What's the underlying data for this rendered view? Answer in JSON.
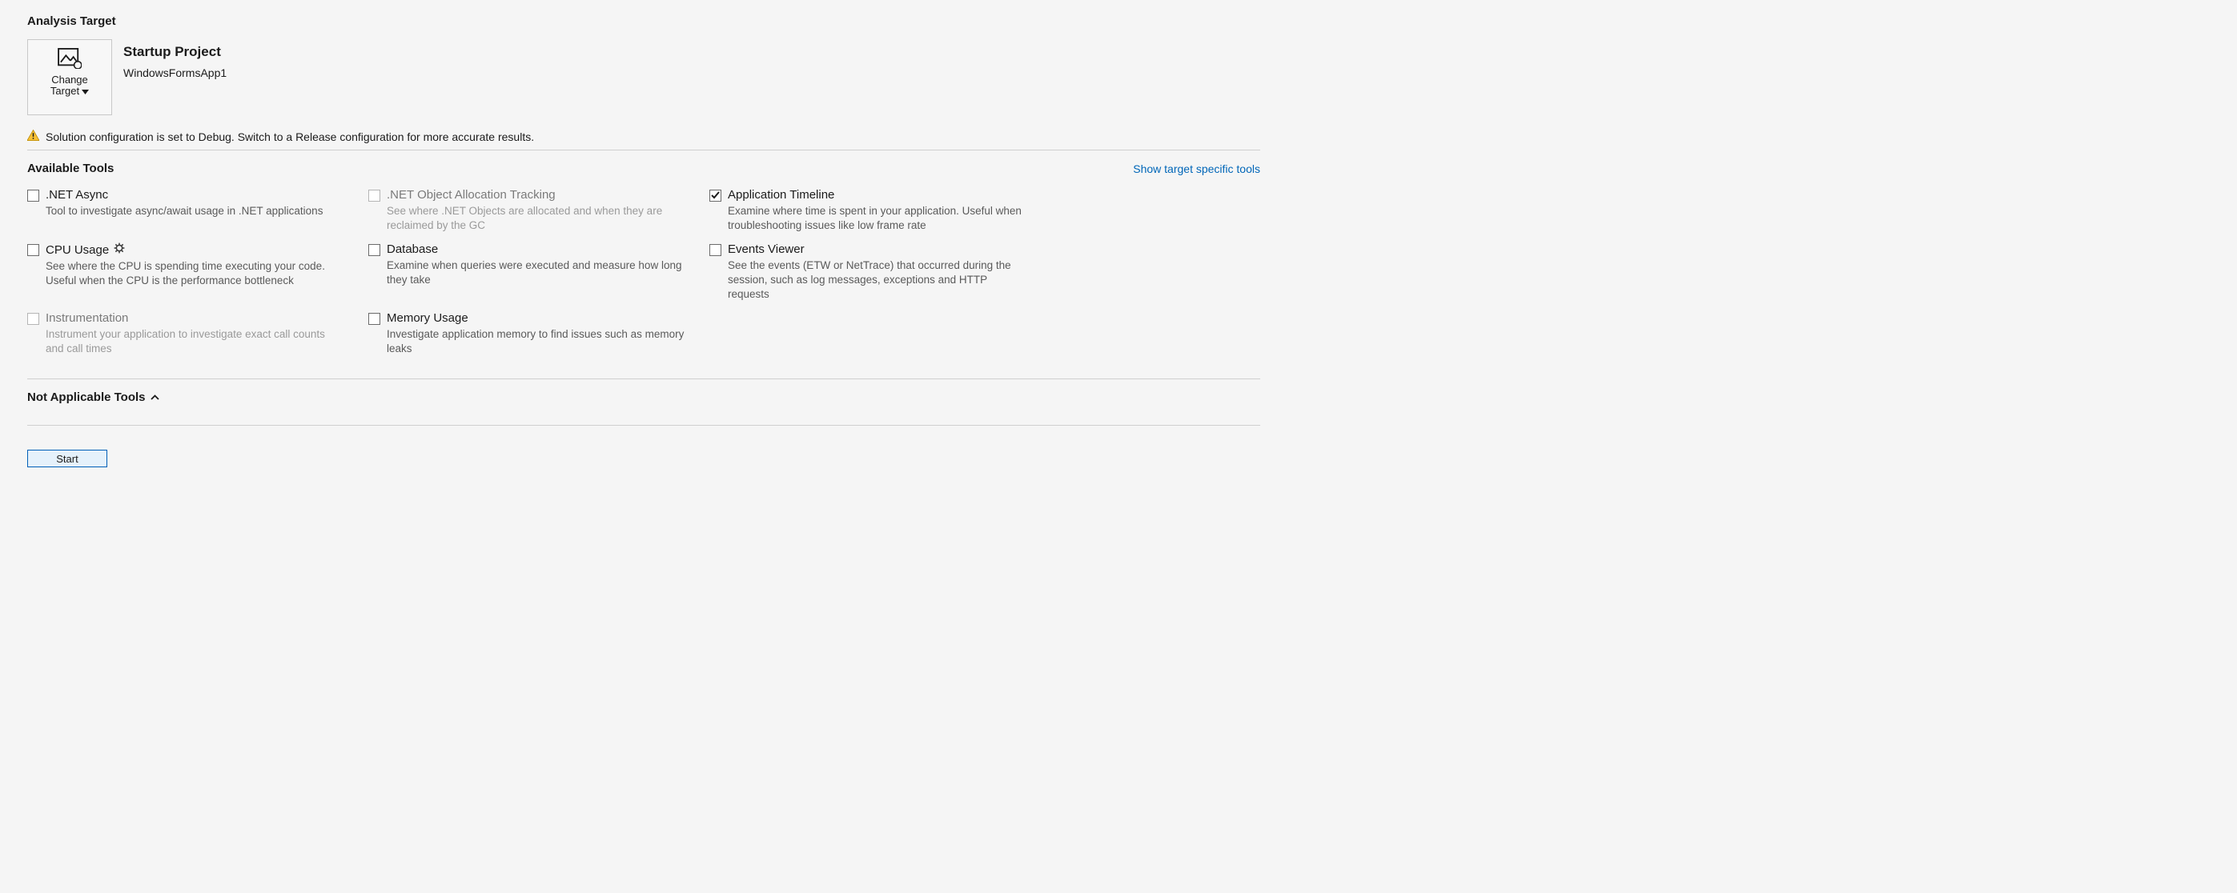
{
  "sections": {
    "analysis_target": "Analysis Target",
    "available_tools": "Available Tools",
    "not_applicable_tools": "Not Applicable Tools"
  },
  "change_target": {
    "line1": "Change",
    "line2": "Target"
  },
  "project": {
    "title": "Startup Project",
    "name": "WindowsFormsApp1"
  },
  "warning": "Solution configuration is set to Debug. Switch to a Release configuration for more accurate results.",
  "link_show_tools": "Show target specific tools",
  "tools": {
    "net_async": {
      "title": ".NET Async",
      "desc": "Tool to investigate async/await usage in .NET applications"
    },
    "obj_alloc": {
      "title": ".NET Object Allocation Tracking",
      "desc": "See where .NET Objects are allocated and when they are reclaimed by the GC"
    },
    "app_timeline": {
      "title": "Application Timeline",
      "desc": "Examine where time is spent in your application. Useful when troubleshooting issues like low frame rate"
    },
    "cpu_usage": {
      "title": "CPU Usage",
      "desc": "See where the CPU is spending time executing your code. Useful when the CPU is the performance bottleneck"
    },
    "database": {
      "title": "Database",
      "desc": "Examine when queries were executed and measure how long they take"
    },
    "events_viewer": {
      "title": "Events Viewer",
      "desc": "See the events (ETW or NetTrace) that occurred during the session, such as log messages, exceptions and HTTP requests"
    },
    "instrumentation": {
      "title": "Instrumentation",
      "desc": "Instrument your application to investigate exact call counts and call times"
    },
    "memory_usage": {
      "title": "Memory Usage",
      "desc": "Investigate application memory to find issues such as memory leaks"
    }
  },
  "start_label": "Start"
}
